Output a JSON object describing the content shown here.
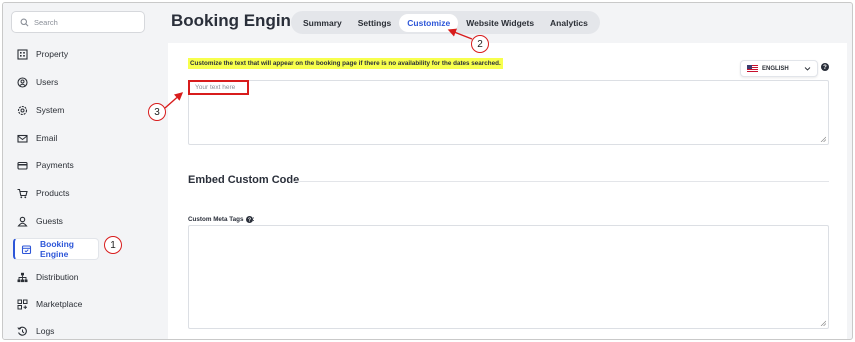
{
  "search": {
    "placeholder": "Search"
  },
  "sidebar": {
    "items": [
      {
        "label": "Property",
        "icon": "building-icon"
      },
      {
        "label": "Users",
        "icon": "user-circle-icon"
      },
      {
        "label": "System",
        "icon": "gear-icon"
      },
      {
        "label": "Email",
        "icon": "envelope-icon"
      },
      {
        "label": "Payments",
        "icon": "credit-card-icon"
      },
      {
        "label": "Products",
        "icon": "cart-icon"
      },
      {
        "label": "Guests",
        "icon": "person-icon"
      },
      {
        "label": "Booking Engine",
        "icon": "calendar-icon",
        "active": true
      },
      {
        "label": "Distribution",
        "icon": "sitemap-icon"
      },
      {
        "label": "Marketplace",
        "icon": "grid-icon"
      },
      {
        "label": "Logs",
        "icon": "history-icon"
      }
    ]
  },
  "header": {
    "title": "Booking Engine",
    "tabs": [
      {
        "label": "Summary"
      },
      {
        "label": "Settings"
      },
      {
        "label": "Customize",
        "active": true
      },
      {
        "label": "Website Widgets"
      },
      {
        "label": "Analytics"
      }
    ]
  },
  "customize": {
    "notice": "Customize the text that will appear on the booking page if there is no availability for the dates searched.",
    "language": "ENGLISH",
    "text_placeholder": "Your text here",
    "embed_title": "Embed Custom Code",
    "meta_label": "Custom Meta Tags",
    "meta_colon": ":"
  },
  "annotations": {
    "one": "1",
    "two": "2",
    "three": "3"
  },
  "colors": {
    "accent": "#2d56d8",
    "highlight": "#f7ff4d",
    "callout": "#d81c1c"
  }
}
